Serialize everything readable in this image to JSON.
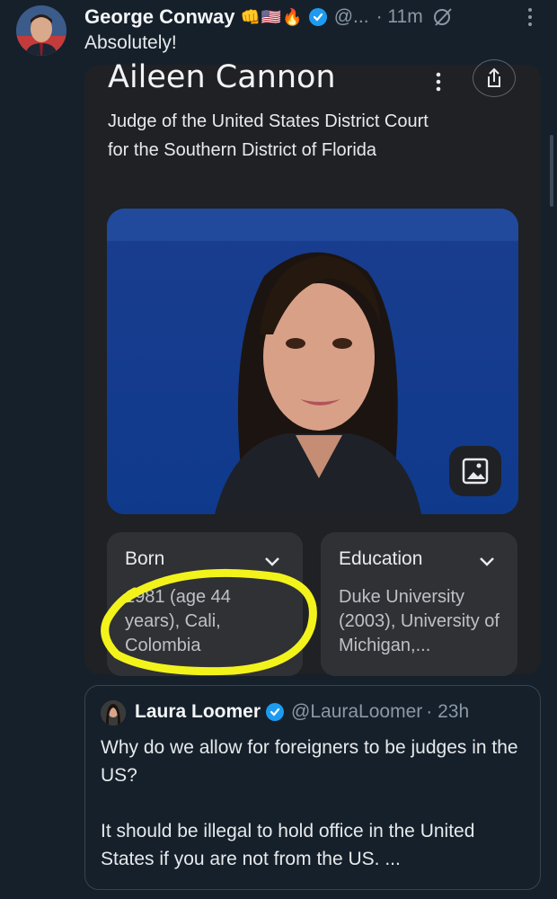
{
  "tweet": {
    "author_name": "George Conway",
    "author_emoji": "👊🇺🇸🔥",
    "handle": "@...",
    "time": "· 11m",
    "text": "Absolutely!"
  },
  "knowledge_panel": {
    "title": "Aileen Cannon",
    "subtitle": "Judge of the United States District Court for the Southern District of Florida",
    "born": {
      "label": "Born",
      "value": "1981 (age 44 years), Cali, Colombia"
    },
    "education": {
      "label": "Education",
      "value": "Duke University (2003), University of Michigan,..."
    }
  },
  "quoted_tweet": {
    "author_name": "Laura Loomer",
    "handle": "@LauraLoomer",
    "time": "· 23h",
    "paragraph1": "Why do we allow for foreigners to be judges in the US?",
    "paragraph2": "It should be illegal to hold office in the United States if you are not from the US. ..."
  },
  "colors": {
    "background": "#15202b",
    "verified_blue": "#1d9bf0",
    "highlight_yellow": "#f3f31c",
    "card": "#202124"
  }
}
